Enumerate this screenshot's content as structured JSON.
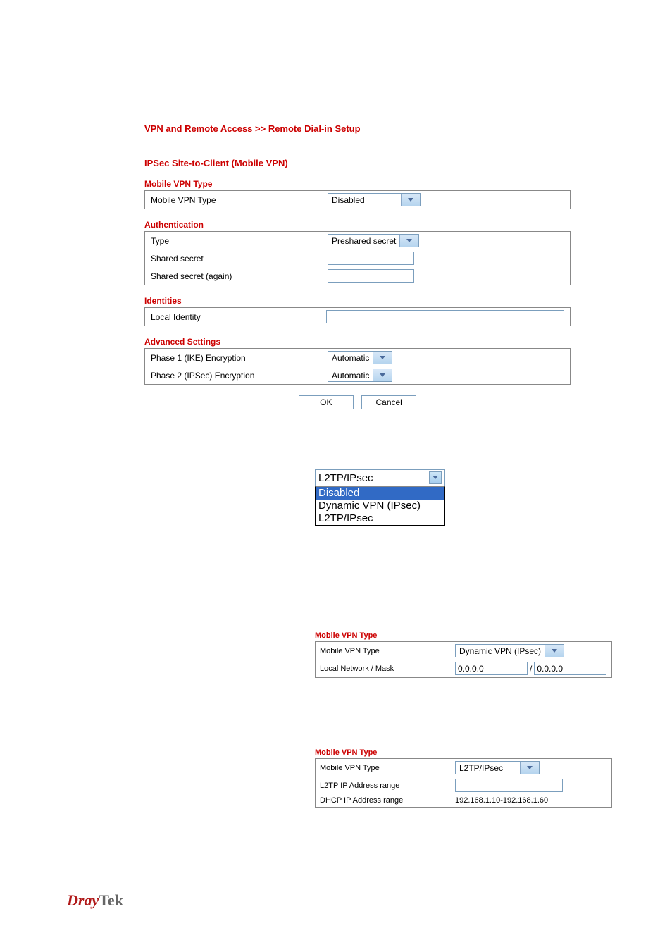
{
  "breadcrumb": "VPN and Remote Access >> Remote Dial-in Setup",
  "sectionTitle": "IPSec Site-to-Client (Mobile VPN)",
  "panel1": {
    "title": "Mobile VPN Type",
    "rows": [
      {
        "label": "Mobile VPN Type",
        "value": "Disabled",
        "options": [
          "Disabled"
        ],
        "type": "select-wide"
      }
    ]
  },
  "panel2": {
    "title": "Authentication",
    "rows": [
      {
        "label": "Type",
        "value": "Preshared secret",
        "options": [
          "Preshared secret"
        ],
        "type": "select"
      },
      {
        "label": "Shared secret",
        "value": "",
        "type": "text"
      },
      {
        "label": "Shared secret (again)",
        "value": "",
        "type": "text"
      }
    ]
  },
  "panel3": {
    "title": "Identities",
    "rows": [
      {
        "label": "Local Identity",
        "value": "",
        "type": "text-wide"
      }
    ]
  },
  "panel4": {
    "title": "Advanced Settings",
    "rows": [
      {
        "label": "Phase 1 (IKE) Encryption",
        "value": "Automatic",
        "options": [
          "Automatic"
        ],
        "type": "select"
      },
      {
        "label": "Phase 2 (IPSec) Encryption",
        "value": "Automatic",
        "options": [
          "Automatic"
        ],
        "type": "select"
      }
    ]
  },
  "buttons": {
    "ok": "OK",
    "cancel": "Cancel"
  },
  "dropdownExpanded": {
    "selected": "L2TP/IPsec",
    "options": [
      "Disabled",
      "Dynamic VPN (IPsec)",
      "L2TP/IPsec"
    ]
  },
  "fig2": {
    "title": "Mobile VPN Type",
    "rows": [
      {
        "label": "Mobile VPN Type",
        "value": "Dynamic VPN (IPsec)",
        "type": "select-med"
      },
      {
        "label": "Local Network / Mask",
        "value1": "0.0.0.0",
        "sep": "/",
        "value2": "0.0.0.0",
        "type": "mask"
      }
    ]
  },
  "fig3": {
    "title": "Mobile VPN Type",
    "rows": [
      {
        "label": "Mobile VPN Type",
        "value": "L2TP/IPsec",
        "type": "select-med"
      },
      {
        "label": "L2TP IP Address range",
        "value": "",
        "type": "text"
      },
      {
        "label": "DHCP IP Address range",
        "value": "192.168.1.10-192.168.1.60",
        "type": "static"
      }
    ]
  },
  "logo": {
    "part1": "Dray",
    "part2": "Tek"
  }
}
